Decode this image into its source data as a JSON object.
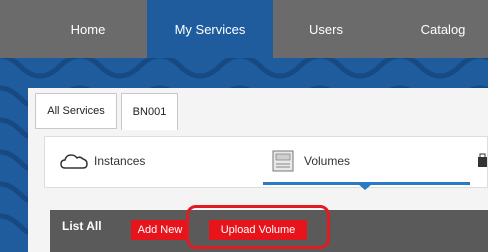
{
  "topnav": {
    "tabs": [
      {
        "label": "Home"
      },
      {
        "label": "My Services"
      },
      {
        "label": "Users"
      },
      {
        "label": "Catalog"
      }
    ],
    "active": "My Services"
  },
  "subtabs": [
    {
      "label": "All Services"
    },
    {
      "label": "BN001"
    }
  ],
  "services": [
    {
      "label": "Instances",
      "icon": "cloud-icon"
    },
    {
      "label": "Volumes",
      "icon": "volume-icon"
    }
  ],
  "list": {
    "title": "List All",
    "add_new_label": "Add New",
    "upload_volume_label": "Upload Volume"
  },
  "colors": {
    "nav_bg": "#6b6b6b",
    "active_tab": "#1f5c9e",
    "accent_blue": "#2a7bc4",
    "button_red": "#e8141c"
  }
}
